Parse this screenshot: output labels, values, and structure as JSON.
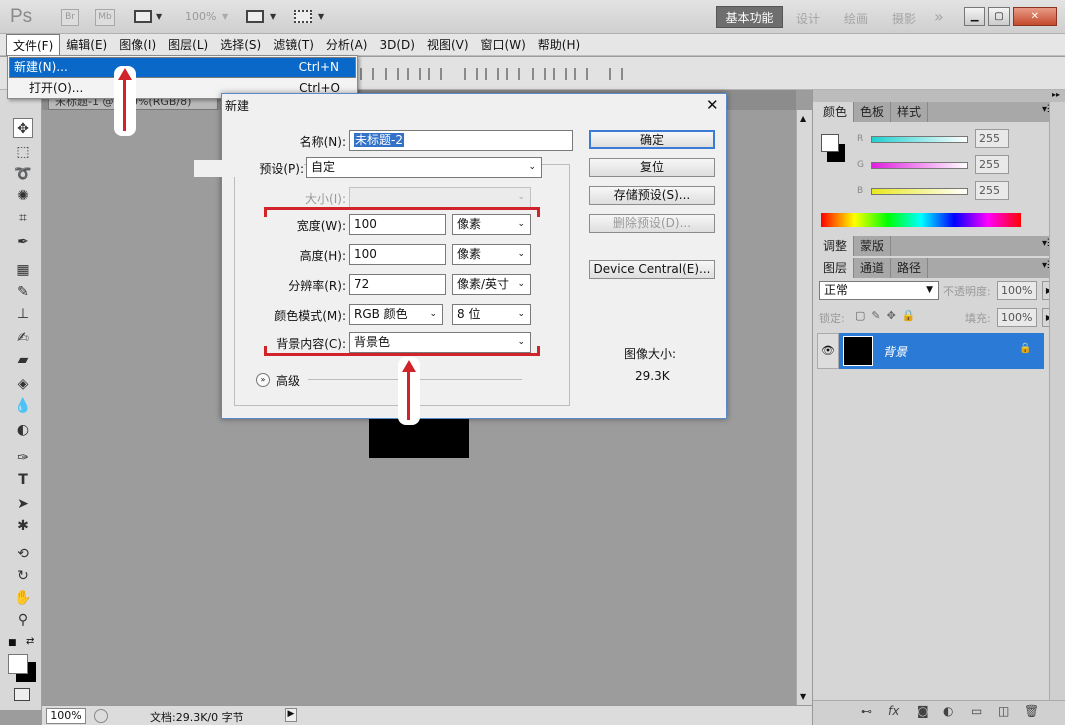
{
  "app": {
    "logo": "Ps",
    "bridge": "Br",
    "minibridge": "Mb",
    "zoom": "100%"
  },
  "workspaces": {
    "active": "基本功能",
    "items": [
      "设计",
      "绘画",
      "摄影"
    ],
    "more": "»"
  },
  "menu": [
    "文件(F)",
    "编辑(E)",
    "图像(I)",
    "图层(L)",
    "选择(S)",
    "滤镜(T)",
    "分析(A)",
    "3D(D)",
    "视图(V)",
    "窗口(W)",
    "帮助(H)"
  ],
  "file_menu": [
    {
      "label": "新建(N)...",
      "shortcut": "Ctrl+N"
    },
    {
      "label": "打开(O)...",
      "shortcut": "Ctrl+O"
    }
  ],
  "doc_tab": "未标题-1 @ 100%(RGB/8)",
  "dialog": {
    "title": "新建",
    "close": "✕",
    "name_label": "名称(N):",
    "name_value": "未标题-2",
    "preset_label": "预设(P):",
    "preset_value": "自定",
    "size_label": "大小(I):",
    "width_label": "宽度(W):",
    "width_value": "100",
    "width_unit": "像素",
    "height_label": "高度(H):",
    "height_value": "100",
    "height_unit": "像素",
    "res_label": "分辨率(R):",
    "res_value": "72",
    "res_unit": "像素/英寸",
    "mode_label": "颜色模式(M):",
    "mode_value": "RGB 颜色",
    "bits_value": "8 位",
    "bg_label": "背景内容(C):",
    "bg_value": "背景色",
    "advanced": "高级",
    "buttons": {
      "ok": "确定",
      "reset": "复位",
      "save_preset": "存储预设(S)...",
      "delete_preset": "删除预设(D)...",
      "device_central": "Device Central(E)..."
    },
    "image_size_label": "图像大小:",
    "image_size_value": "29.3K"
  },
  "status": {
    "zoom": "100%",
    "doc": "文档:29.3K/0 字节"
  },
  "panels": {
    "color_tabs": [
      "颜色",
      "色板",
      "样式"
    ],
    "channels": [
      {
        "name": "R",
        "value": "255",
        "color": "#20d0d0"
      },
      {
        "name": "G",
        "value": "255",
        "color": "#e020e0"
      },
      {
        "name": "B",
        "value": "255",
        "color": "#e8e820"
      }
    ],
    "adjust_tabs": [
      "调整",
      "蒙版"
    ],
    "layer_tabs": [
      "图层",
      "通道",
      "路径"
    ],
    "blend_mode": "正常",
    "opacity_label": "不透明度:",
    "opacity_value": "100%",
    "lock_label": "锁定:",
    "fill_label": "填充:",
    "fill_value": "100%",
    "layer_name": "背景",
    "footer_icons": "fx"
  },
  "colors": {
    "accent": "#0a69c8",
    "annotation": "#d0232a"
  }
}
